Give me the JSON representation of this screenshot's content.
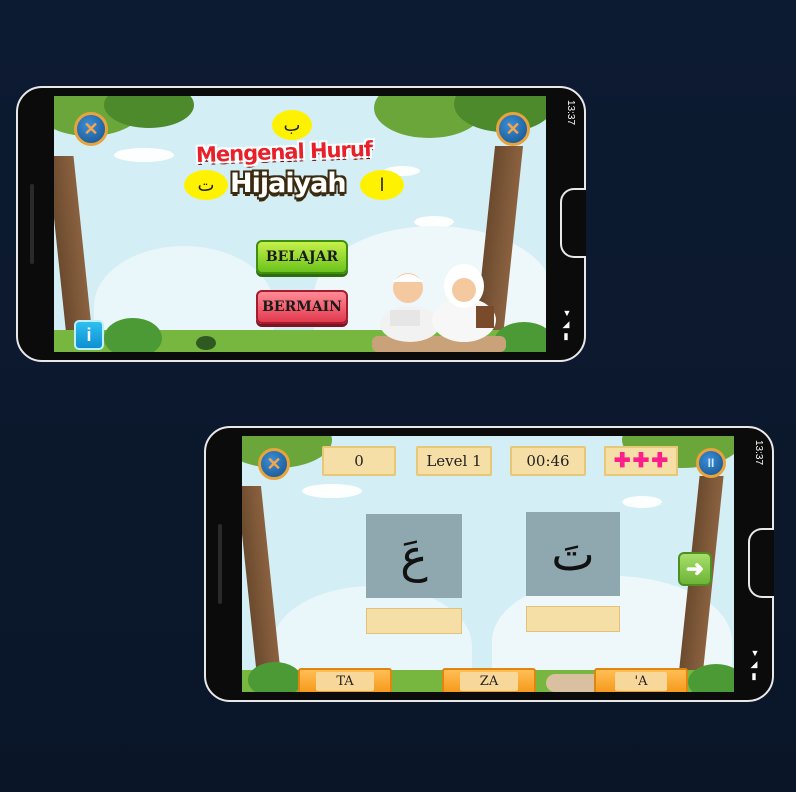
{
  "home": {
    "status_time": "13:37",
    "title_line1": "Mengenal Huruf",
    "title_line2": "Hijaiyah",
    "letter_ba": "ب",
    "letter_ta": "ت",
    "letter_alif": "ا",
    "belajar_label": "BELAJAR",
    "bermain_label": "BERMAIN",
    "close_icon_glyph": "✕",
    "sound_icon_glyph": "✕",
    "info_icon_glyph": "i"
  },
  "game": {
    "status_time": "13:37",
    "score": "0",
    "level_label": "Level  1",
    "timer": "00:46",
    "lives_count": 3,
    "card_left_letter": "عَ",
    "card_right_letter": "تَ",
    "answers": [
      "TA",
      "ZA",
      "'A"
    ],
    "close_icon_glyph": "✕",
    "pause_icon_glyph": "II",
    "next_icon_glyph": "➜"
  },
  "colors": {
    "accent_green": "#6bc21c",
    "accent_red": "#e23a4e",
    "accent_orange": "#f59a1c",
    "lives_pink": "#ff1f8a",
    "background": "#0d1b32"
  }
}
